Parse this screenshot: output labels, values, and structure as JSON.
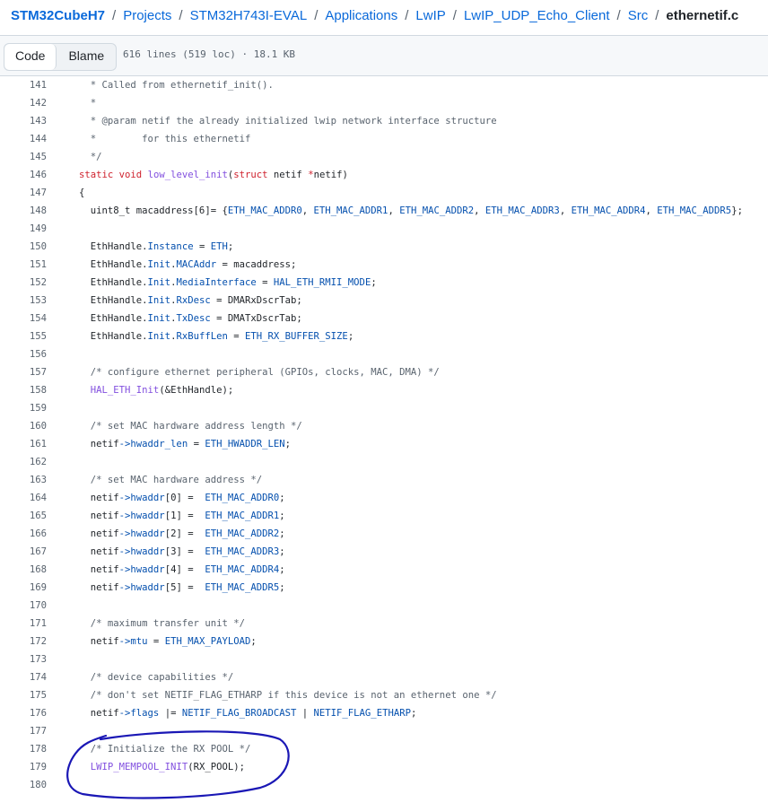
{
  "breadcrumb": {
    "items": [
      "STM32CubeH7",
      "Projects",
      "STM32H743I-EVAL",
      "Applications",
      "LwIP",
      "LwIP_UDP_Echo_Client",
      "Src"
    ],
    "separator": "/",
    "current": "ethernetif.c"
  },
  "toolbar": {
    "code_label": "Code",
    "blame_label": "Blame",
    "file_info": "616 lines (519 loc) · 18.1 KB"
  },
  "code_lines": [
    {
      "n": "141",
      "t": [
        {
          "k": "cmt",
          "s": "  * Called from ethernetif_init()."
        }
      ]
    },
    {
      "n": "142",
      "t": [
        {
          "k": "cmt",
          "s": "  *"
        }
      ]
    },
    {
      "n": "143",
      "t": [
        {
          "k": "cmt",
          "s": "  * @param netif the already initialized lwip network interface structure"
        }
      ]
    },
    {
      "n": "144",
      "t": [
        {
          "k": "cmt",
          "s": "  *        for this ethernetif"
        }
      ]
    },
    {
      "n": "145",
      "t": [
        {
          "k": "cmt",
          "s": "  */"
        }
      ]
    },
    {
      "n": "146",
      "t": [
        {
          "k": "kw",
          "s": "static"
        },
        {
          "k": "plain",
          "s": " "
        },
        {
          "k": "kw",
          "s": "void"
        },
        {
          "k": "plain",
          "s": " "
        },
        {
          "k": "fn",
          "s": "low_level_init"
        },
        {
          "k": "plain",
          "s": "("
        },
        {
          "k": "kw",
          "s": "struct"
        },
        {
          "k": "plain",
          "s": " netif "
        },
        {
          "k": "kw",
          "s": "*"
        },
        {
          "k": "plain",
          "s": "netif)"
        }
      ]
    },
    {
      "n": "147",
      "t": [
        {
          "k": "plain",
          "s": "{"
        }
      ]
    },
    {
      "n": "148",
      "t": [
        {
          "k": "plain",
          "s": "  uint8_t macaddress[6]= {"
        },
        {
          "k": "cst",
          "s": "ETH_MAC_ADDR0"
        },
        {
          "k": "plain",
          "s": ", "
        },
        {
          "k": "cst",
          "s": "ETH_MAC_ADDR1"
        },
        {
          "k": "plain",
          "s": ", "
        },
        {
          "k": "cst",
          "s": "ETH_MAC_ADDR2"
        },
        {
          "k": "plain",
          "s": ", "
        },
        {
          "k": "cst",
          "s": "ETH_MAC_ADDR3"
        },
        {
          "k": "plain",
          "s": ", "
        },
        {
          "k": "cst",
          "s": "ETH_MAC_ADDR4"
        },
        {
          "k": "plain",
          "s": ", "
        },
        {
          "k": "cst",
          "s": "ETH_MAC_ADDR5"
        },
        {
          "k": "plain",
          "s": "};"
        }
      ]
    },
    {
      "n": "149",
      "t": []
    },
    {
      "n": "150",
      "t": [
        {
          "k": "plain",
          "s": "  EthHandle."
        },
        {
          "k": "cst",
          "s": "Instance"
        },
        {
          "k": "plain",
          "s": " = "
        },
        {
          "k": "cst",
          "s": "ETH"
        },
        {
          "k": "plain",
          "s": ";"
        }
      ]
    },
    {
      "n": "151",
      "t": [
        {
          "k": "plain",
          "s": "  EthHandle."
        },
        {
          "k": "cst",
          "s": "Init"
        },
        {
          "k": "plain",
          "s": "."
        },
        {
          "k": "cst",
          "s": "MACAddr"
        },
        {
          "k": "plain",
          "s": " = macaddress;"
        }
      ]
    },
    {
      "n": "152",
      "t": [
        {
          "k": "plain",
          "s": "  EthHandle."
        },
        {
          "k": "cst",
          "s": "Init"
        },
        {
          "k": "plain",
          "s": "."
        },
        {
          "k": "cst",
          "s": "MediaInterface"
        },
        {
          "k": "plain",
          "s": " = "
        },
        {
          "k": "cst",
          "s": "HAL_ETH_RMII_MODE"
        },
        {
          "k": "plain",
          "s": ";"
        }
      ]
    },
    {
      "n": "153",
      "t": [
        {
          "k": "plain",
          "s": "  EthHandle."
        },
        {
          "k": "cst",
          "s": "Init"
        },
        {
          "k": "plain",
          "s": "."
        },
        {
          "k": "cst",
          "s": "RxDesc"
        },
        {
          "k": "plain",
          "s": " = DMARxDscrTab;"
        }
      ]
    },
    {
      "n": "154",
      "t": [
        {
          "k": "plain",
          "s": "  EthHandle."
        },
        {
          "k": "cst",
          "s": "Init"
        },
        {
          "k": "plain",
          "s": "."
        },
        {
          "k": "cst",
          "s": "TxDesc"
        },
        {
          "k": "plain",
          "s": " = DMATxDscrTab;"
        }
      ]
    },
    {
      "n": "155",
      "t": [
        {
          "k": "plain",
          "s": "  EthHandle."
        },
        {
          "k": "cst",
          "s": "Init"
        },
        {
          "k": "plain",
          "s": "."
        },
        {
          "k": "cst",
          "s": "RxBuffLen"
        },
        {
          "k": "plain",
          "s": " = "
        },
        {
          "k": "cst",
          "s": "ETH_RX_BUFFER_SIZE"
        },
        {
          "k": "plain",
          "s": ";"
        }
      ]
    },
    {
      "n": "156",
      "t": []
    },
    {
      "n": "157",
      "t": [
        {
          "k": "cmt",
          "s": "  /* configure ethernet peripheral (GPIOs, clocks, MAC, DMA) */"
        }
      ]
    },
    {
      "n": "158",
      "t": [
        {
          "k": "plain",
          "s": "  "
        },
        {
          "k": "fn",
          "s": "HAL_ETH_Init"
        },
        {
          "k": "plain",
          "s": "(&EthHandle);"
        }
      ]
    },
    {
      "n": "159",
      "t": []
    },
    {
      "n": "160",
      "t": [
        {
          "k": "cmt",
          "s": "  /* set MAC hardware address length */"
        }
      ]
    },
    {
      "n": "161",
      "t": [
        {
          "k": "plain",
          "s": "  netif"
        },
        {
          "k": "cst",
          "s": "->hwaddr_len"
        },
        {
          "k": "plain",
          "s": " = "
        },
        {
          "k": "cst",
          "s": "ETH_HWADDR_LEN"
        },
        {
          "k": "plain",
          "s": ";"
        }
      ]
    },
    {
      "n": "162",
      "t": []
    },
    {
      "n": "163",
      "t": [
        {
          "k": "cmt",
          "s": "  /* set MAC hardware address */"
        }
      ]
    },
    {
      "n": "164",
      "t": [
        {
          "k": "plain",
          "s": "  netif"
        },
        {
          "k": "cst",
          "s": "->hwaddr"
        },
        {
          "k": "plain",
          "s": "[0] =  "
        },
        {
          "k": "cst",
          "s": "ETH_MAC_ADDR0"
        },
        {
          "k": "plain",
          "s": ";"
        }
      ]
    },
    {
      "n": "165",
      "t": [
        {
          "k": "plain",
          "s": "  netif"
        },
        {
          "k": "cst",
          "s": "->hwaddr"
        },
        {
          "k": "plain",
          "s": "[1] =  "
        },
        {
          "k": "cst",
          "s": "ETH_MAC_ADDR1"
        },
        {
          "k": "plain",
          "s": ";"
        }
      ]
    },
    {
      "n": "166",
      "t": [
        {
          "k": "plain",
          "s": "  netif"
        },
        {
          "k": "cst",
          "s": "->hwaddr"
        },
        {
          "k": "plain",
          "s": "[2] =  "
        },
        {
          "k": "cst",
          "s": "ETH_MAC_ADDR2"
        },
        {
          "k": "plain",
          "s": ";"
        }
      ]
    },
    {
      "n": "167",
      "t": [
        {
          "k": "plain",
          "s": "  netif"
        },
        {
          "k": "cst",
          "s": "->hwaddr"
        },
        {
          "k": "plain",
          "s": "[3] =  "
        },
        {
          "k": "cst",
          "s": "ETH_MAC_ADDR3"
        },
        {
          "k": "plain",
          "s": ";"
        }
      ]
    },
    {
      "n": "168",
      "t": [
        {
          "k": "plain",
          "s": "  netif"
        },
        {
          "k": "cst",
          "s": "->hwaddr"
        },
        {
          "k": "plain",
          "s": "[4] =  "
        },
        {
          "k": "cst",
          "s": "ETH_MAC_ADDR4"
        },
        {
          "k": "plain",
          "s": ";"
        }
      ]
    },
    {
      "n": "169",
      "t": [
        {
          "k": "plain",
          "s": "  netif"
        },
        {
          "k": "cst",
          "s": "->hwaddr"
        },
        {
          "k": "plain",
          "s": "[5] =  "
        },
        {
          "k": "cst",
          "s": "ETH_MAC_ADDR5"
        },
        {
          "k": "plain",
          "s": ";"
        }
      ]
    },
    {
      "n": "170",
      "t": []
    },
    {
      "n": "171",
      "t": [
        {
          "k": "cmt",
          "s": "  /* maximum transfer unit */"
        }
      ]
    },
    {
      "n": "172",
      "t": [
        {
          "k": "plain",
          "s": "  netif"
        },
        {
          "k": "cst",
          "s": "->mtu"
        },
        {
          "k": "plain",
          "s": " = "
        },
        {
          "k": "cst",
          "s": "ETH_MAX_PAYLOAD"
        },
        {
          "k": "plain",
          "s": ";"
        }
      ]
    },
    {
      "n": "173",
      "t": []
    },
    {
      "n": "174",
      "t": [
        {
          "k": "cmt",
          "s": "  /* device capabilities */"
        }
      ]
    },
    {
      "n": "175",
      "t": [
        {
          "k": "cmt",
          "s": "  /* don't set NETIF_FLAG_ETHARP if this device is not an ethernet one */"
        }
      ]
    },
    {
      "n": "176",
      "t": [
        {
          "k": "plain",
          "s": "  netif"
        },
        {
          "k": "cst",
          "s": "->flags"
        },
        {
          "k": "plain",
          "s": " |= "
        },
        {
          "k": "cst",
          "s": "NETIF_FLAG_BROADCAST"
        },
        {
          "k": "plain",
          "s": " | "
        },
        {
          "k": "cst",
          "s": "NETIF_FLAG_ETHARP"
        },
        {
          "k": "plain",
          "s": ";"
        }
      ]
    },
    {
      "n": "177",
      "t": []
    },
    {
      "n": "178",
      "t": [
        {
          "k": "cmt",
          "s": "  /* Initialize the RX POOL */"
        }
      ]
    },
    {
      "n": "179",
      "t": [
        {
          "k": "plain",
          "s": "  "
        },
        {
          "k": "fn",
          "s": "LWIP_MEMPOOL_INIT"
        },
        {
          "k": "plain",
          "s": "(RX_POOL);"
        }
      ]
    },
    {
      "n": "180",
      "t": []
    }
  ],
  "colors": {
    "link": "#0969da",
    "keyword": "#cf222e",
    "function": "#8250df",
    "constant": "#0550ae",
    "comment": "#59636e",
    "annotation": "#1a17b5"
  }
}
